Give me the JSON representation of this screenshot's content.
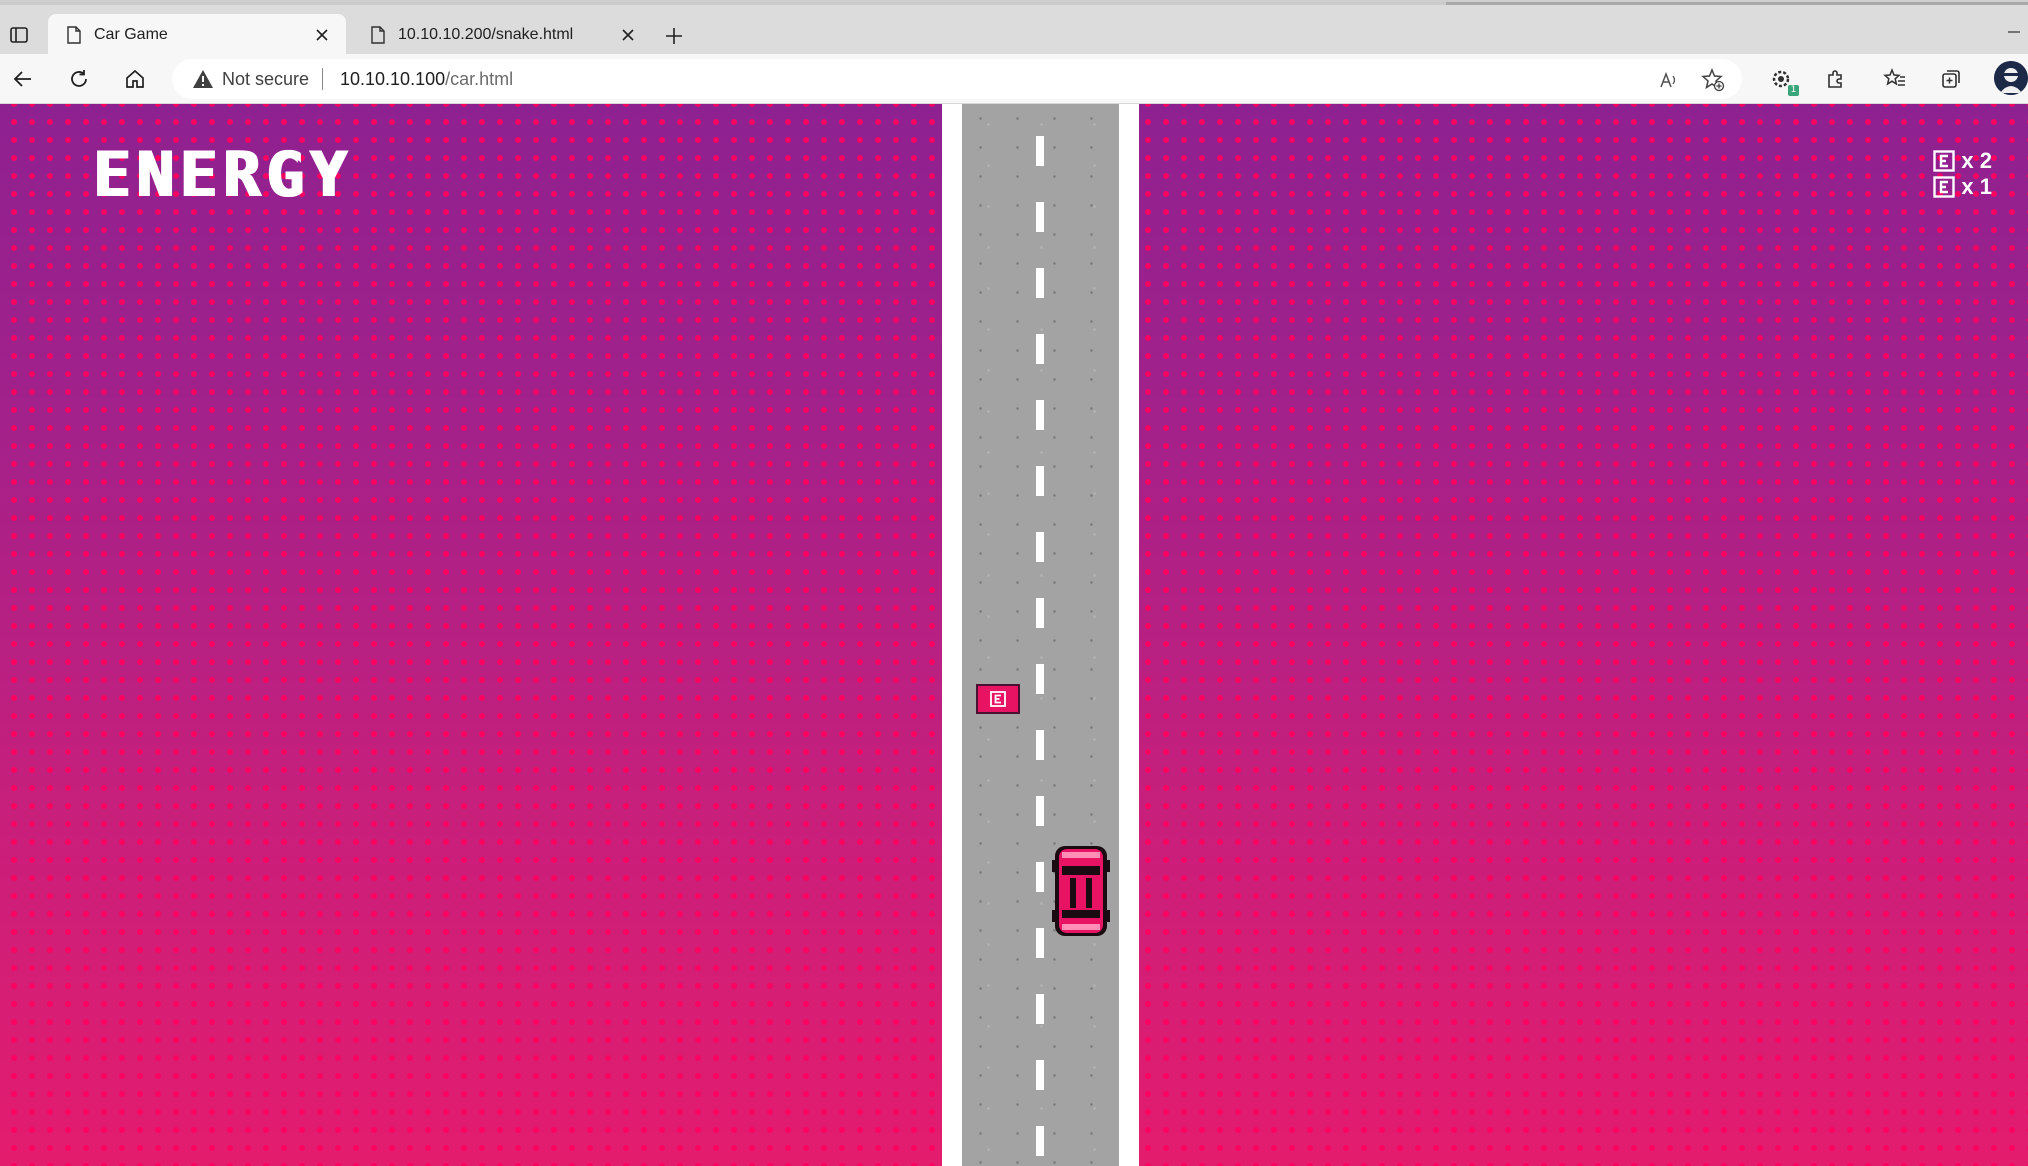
{
  "browser": {
    "tabs": [
      {
        "title": "Car Game",
        "active": true
      },
      {
        "title": "10.10.10.200/snake.html",
        "active": false
      }
    ],
    "address_bar": {
      "security_label": "Not secure",
      "url_host": "10.10.10.100",
      "url_path": "/car.html"
    },
    "toolbar_icons": [
      "back-arrow-icon",
      "reload-icon",
      "home-icon",
      "read-aloud-icon",
      "add-favorite-icon",
      "extension-status-icon",
      "extensions-icon",
      "favorites-icon",
      "collections-icon",
      "profile-avatar"
    ],
    "extension_badge": "1"
  },
  "game": {
    "title": "ENERGY",
    "counters": [
      {
        "label": "x 2"
      },
      {
        "label": "x 1"
      }
    ],
    "colors": {
      "background_top": "#8e2190",
      "background_bottom": "#e41c6e",
      "dot": "#ff005f",
      "road": "#a3a3a3",
      "shoulder": "#ffffff",
      "car": "#e81463"
    }
  }
}
